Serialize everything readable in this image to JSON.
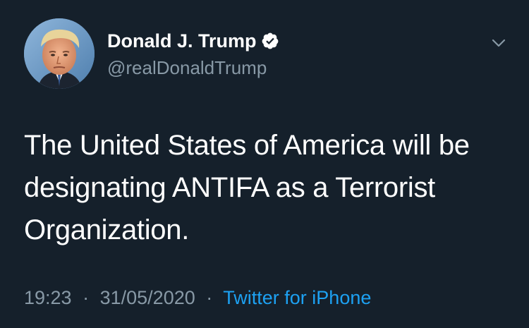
{
  "author": {
    "display_name": "Donald J. Trump",
    "handle": "@realDonaldTrump",
    "verified": true
  },
  "tweet": {
    "text": "The United States of America will be designating ANTIFA as a Terrorist Organization.",
    "time": "19:23",
    "date": "31/05/2020",
    "separator": "·",
    "source": "Twitter for iPhone"
  },
  "icons": {
    "verified": "verified-badge-icon",
    "menu": "chevron-down-icon"
  },
  "colors": {
    "background": "#15202b",
    "text_primary": "#ffffff",
    "text_secondary": "#8899a6",
    "accent": "#1da1f2"
  }
}
